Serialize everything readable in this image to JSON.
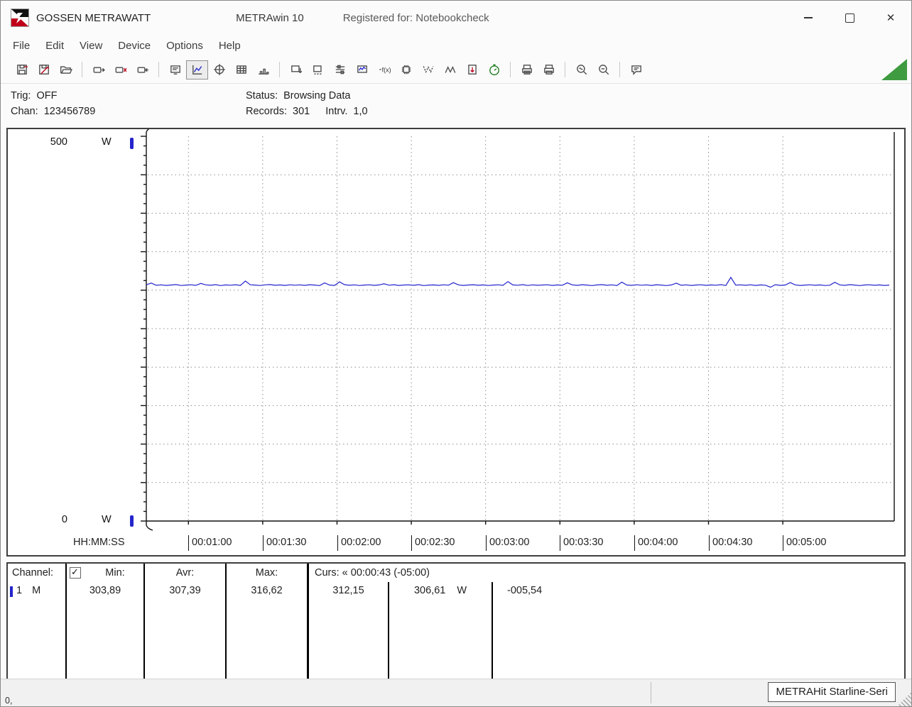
{
  "window": {
    "app_name": "GOSSEN METRAWATT",
    "product": "METRAwin 10",
    "registered": "Registered for: Notebookcheck",
    "control_icons": [
      "minimize-icon",
      "maximize-icon",
      "close-icon"
    ]
  },
  "menu": {
    "items": [
      "File",
      "Edit",
      "View",
      "Device",
      "Options",
      "Help"
    ]
  },
  "toolbar": {
    "buttons": [
      "save",
      "save-as",
      "open",
      "device-send",
      "device-read",
      "device-eject",
      "display",
      "line-chart",
      "scope",
      "table",
      "histogram",
      "transfer",
      "connect",
      "list-settings",
      "monitor",
      "function",
      "memory",
      "min-curve",
      "max-curve",
      "export",
      "timer",
      "print-preview",
      "print",
      "zoom-mode",
      "zoom-out",
      "note"
    ],
    "active_button": "line-chart",
    "timer_color": "#1c7a1c",
    "corner_triangle_color": "#3f9b3f"
  },
  "readouts": {
    "trig_label": "Trig:",
    "trig_value": "OFF",
    "chan_label": "Chan:",
    "chan_value": "123456789",
    "status_label": "Status:",
    "status_value": "Browsing Data",
    "records_label": "Records:",
    "records_value": "301",
    "interval_label": "Intrv.",
    "interval_value": "1,0"
  },
  "chart_data": {
    "type": "line",
    "title": "",
    "x_axis_label": "HH:MM:SS",
    "x_tick_labels": [
      "00:01:00",
      "00:01:30",
      "00:02:00",
      "00:02:30",
      "00:03:00",
      "00:03:30",
      "00:04:00",
      "00:04:30",
      "00:05:00"
    ],
    "x_tick_seconds": [
      60,
      90,
      120,
      150,
      180,
      210,
      240,
      270,
      300
    ],
    "x_window_seconds": [
      43,
      345
    ],
    "ylim": [
      0,
      500
    ],
    "y_major_step": 50,
    "y_minor_step": 12.5,
    "y_top_label": "500",
    "y_bottom_label": "0",
    "y_unit": "W",
    "grid": true,
    "legend": false,
    "series": [
      {
        "name": "Channel 1",
        "unit": "W",
        "color": "#2424cc",
        "start_seconds": 43,
        "interval_seconds": 2,
        "values": [
          307.0,
          309.2,
          306.4,
          306.9,
          306.2,
          306.7,
          307.3,
          306.1,
          306.6,
          307.0,
          306.3,
          308.8,
          306.9,
          306.4,
          307.2,
          306.0,
          306.8,
          306.5,
          307.1,
          306.2,
          311.9,
          307.0,
          306.6,
          306.1,
          306.9,
          307.3,
          306.4,
          306.8,
          306.2,
          307.0,
          306.5,
          306.9,
          306.3,
          307.1,
          306.6,
          306.0,
          309.4,
          306.7,
          306.2,
          310.8,
          307.2,
          306.4,
          306.9,
          306.1,
          306.6,
          307.0,
          306.3,
          306.8,
          308.3,
          306.5,
          307.1,
          306.2,
          306.7,
          306.9,
          306.4,
          307.2,
          306.0,
          306.6,
          306.8,
          306.3,
          307.0,
          306.5,
          309.8,
          306.9,
          306.2,
          306.7,
          307.1,
          306.4,
          306.8,
          306.1,
          306.6,
          307.0,
          306.3,
          311.2,
          306.8,
          306.5,
          307.2,
          306.1,
          306.9,
          306.4,
          306.7,
          307.0,
          306.2,
          306.8,
          306.5,
          309.6,
          306.9,
          306.3,
          307.1,
          306.6,
          306.0,
          306.8,
          307.2,
          306.4,
          306.9,
          306.1,
          310.4,
          306.7,
          306.3,
          307.0,
          306.5,
          306.9,
          306.2,
          307.1,
          306.6,
          306.0,
          306.8,
          309.1,
          306.4,
          306.9,
          306.2,
          306.7,
          307.0,
          306.3,
          306.8,
          306.5,
          307.2,
          306.1,
          316.6,
          306.6,
          306.9,
          306.4,
          307.0,
          306.2,
          306.8,
          306.5,
          303.9,
          307.1,
          306.3,
          306.7,
          309.9,
          306.9,
          306.2,
          306.6,
          307.0,
          306.4,
          306.8,
          306.1,
          306.5,
          310.2,
          306.9,
          306.3,
          307.2,
          306.6,
          306.0,
          306.7,
          307.0,
          306.4,
          306.8,
          306.2,
          306.6
        ]
      }
    ]
  },
  "table": {
    "header": {
      "channel": "Channel:",
      "checkbox_checked": true,
      "min": "Min:",
      "avr": "Avr:",
      "max": "Max:",
      "cursor": "Curs: « 00:00:43 (-05:00)"
    },
    "row": {
      "channel": "1",
      "mode": "M",
      "min": "303,89",
      "avr": "307,39",
      "max": "316,62",
      "cursor_value_1": "312,15",
      "cursor_value_2": "306,61",
      "unit": "W",
      "delta": "-005,54"
    }
  },
  "statusbar": {
    "left": "0,",
    "device": "METRAHit Starline-Seri"
  }
}
